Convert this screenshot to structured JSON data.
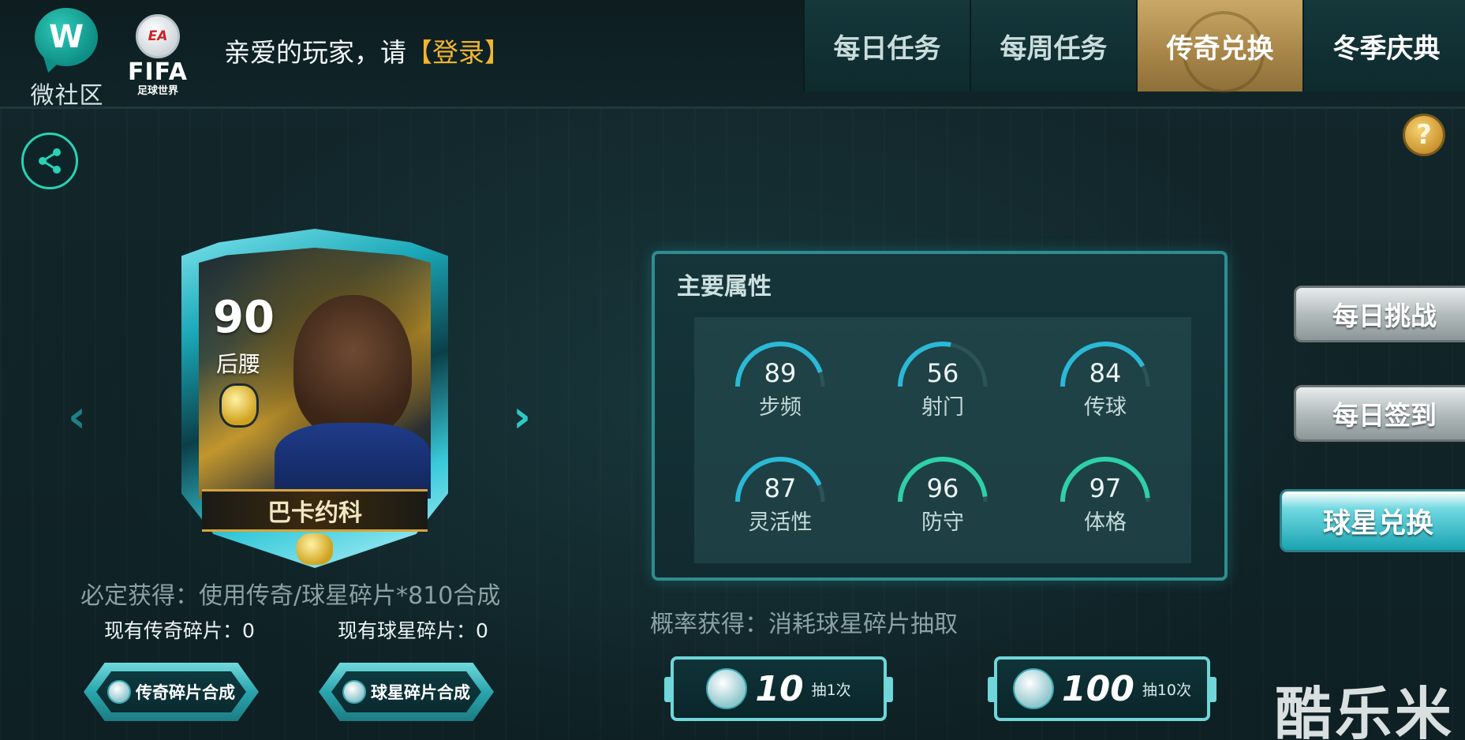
{
  "header": {
    "community_label": "微社区",
    "fifa": {
      "ea": "EA",
      "title": "FIFA",
      "subtitle": "足球世界"
    },
    "greeting": "亲爱的玩家，请",
    "login": "【登录】",
    "tabs": [
      {
        "label": "每日任务"
      },
      {
        "label": "每周任务"
      },
      {
        "label": "传奇兑换",
        "active": true
      },
      {
        "label": "冬季庆典"
      }
    ]
  },
  "help": {
    "icon": "?"
  },
  "card": {
    "rating": "90",
    "position": "后腰",
    "name": "巴卡约科",
    "prev_icon": "‹",
    "next_icon": "›"
  },
  "acquire": {
    "guaranteed": "必定获得：使用传奇/球星碎片*810合成",
    "legend_owned": "现有传奇碎片：0",
    "star_owned": "现有球星碎片：0",
    "legend_button": "传奇碎片合成",
    "star_button": "球星碎片合成"
  },
  "attributes": {
    "title": "主要属性",
    "stats": [
      {
        "value": "89",
        "label": "步频",
        "level": 0.89
      },
      {
        "value": "56",
        "label": "射门",
        "level": 0.56
      },
      {
        "value": "84",
        "label": "传球",
        "level": 0.84
      },
      {
        "value": "87",
        "label": "灵活性",
        "level": 0.87
      },
      {
        "value": "96",
        "label": "防守",
        "level": 0.96
      },
      {
        "value": "97",
        "label": "体格",
        "level": 0.97
      }
    ]
  },
  "draw": {
    "probability": "概率获得：消耗球星碎片抽取",
    "single": {
      "cost": "10",
      "times": "抽1次"
    },
    "ten": {
      "cost": "100",
      "times": "抽10次"
    }
  },
  "side": {
    "daily_challenge": "每日挑战",
    "daily_signin": "每日签到",
    "star_exchange": "球星兑换"
  },
  "watermark": "酷乐米",
  "colors": {
    "accent": "#2fc7c7",
    "gold": "#f0b531",
    "active_tab": "#b08f4f"
  }
}
